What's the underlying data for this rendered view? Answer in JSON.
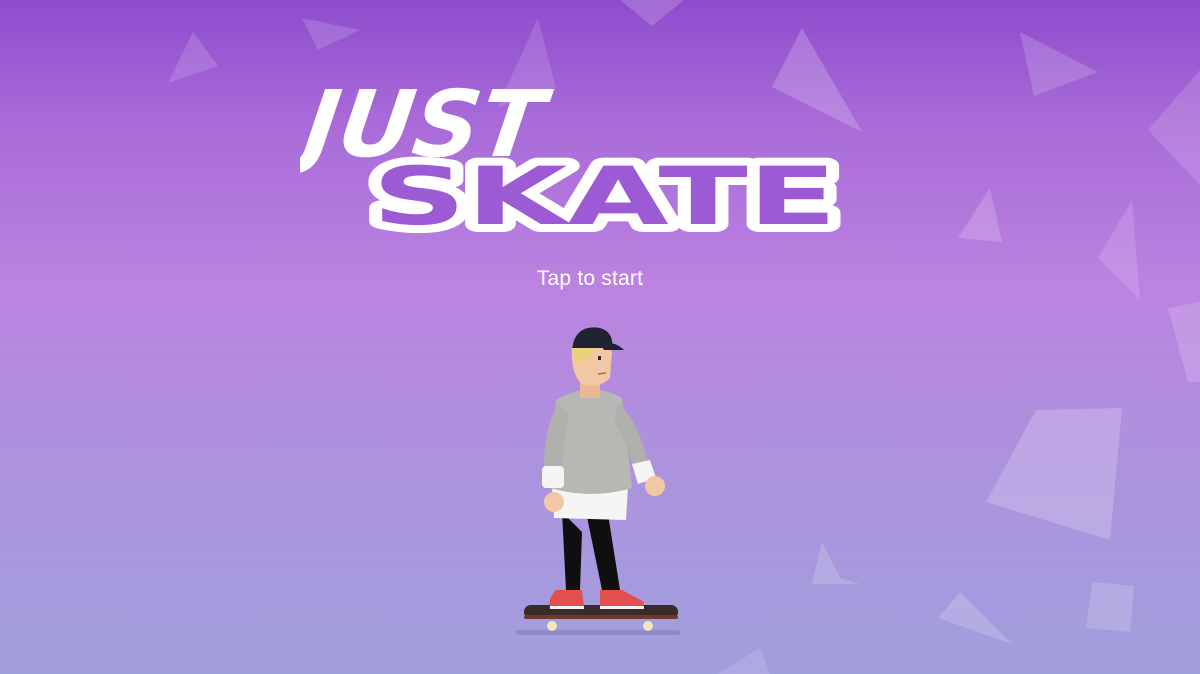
{
  "game": {
    "title_line1": "JUST",
    "title_line2": "SKATE",
    "start_prompt": "Tap to start"
  },
  "colors": {
    "background_top": "#8e4ccc",
    "background_mid": "#bb82e0",
    "background_bottom": "#a19fdd",
    "title": "#ffffff",
    "shard": "#ffffff"
  },
  "icons": {
    "character": "skater-character-icon",
    "skateboard": "skateboard-icon",
    "decoration": "polygon-shard-icon"
  }
}
